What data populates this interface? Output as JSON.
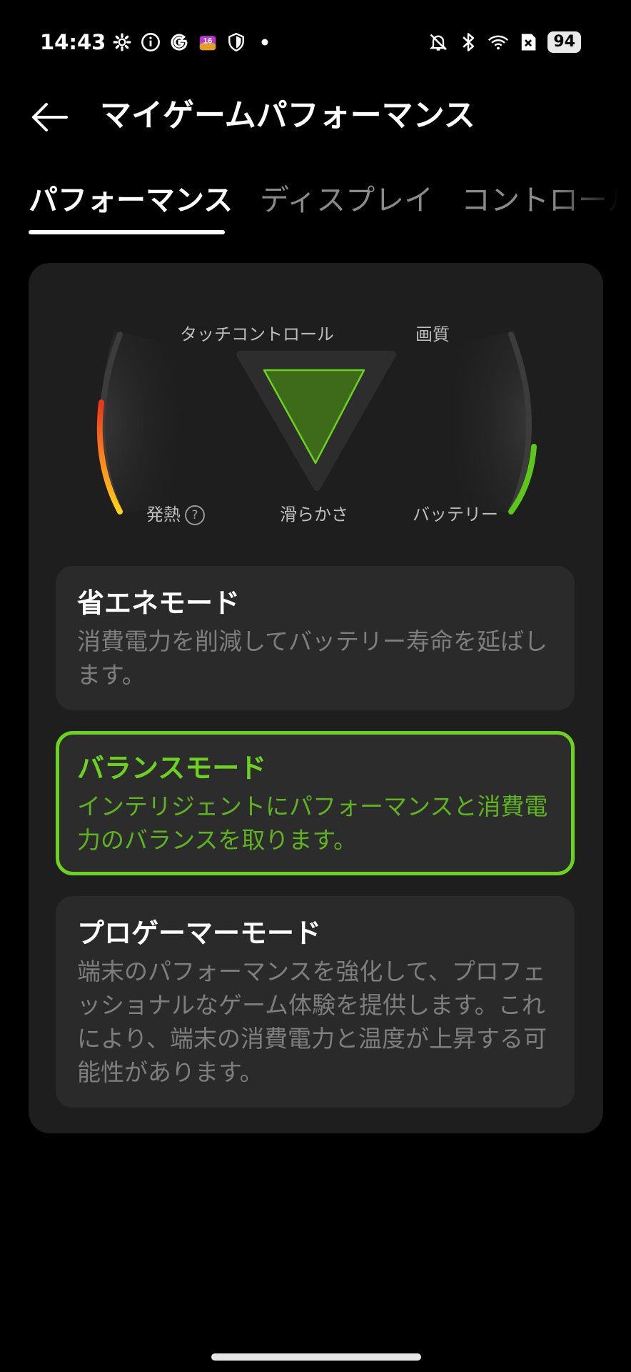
{
  "status_bar": {
    "time": "14:43",
    "left_icons": [
      "gear-icon",
      "info-icon",
      "google-icon",
      "app-icon",
      "shield-icon",
      "dot-icon"
    ],
    "right_icons": [
      "bell-off-icon",
      "bluetooth-icon",
      "wifi-icon",
      "sim-off-icon"
    ],
    "battery": "94"
  },
  "header": {
    "title": "マイゲームパフォーマンス"
  },
  "tabs": [
    {
      "label": "パフォーマンス",
      "active": true
    },
    {
      "label": "ディスプレイ",
      "active": false
    },
    {
      "label": "コントロール",
      "active": false
    }
  ],
  "gauge": {
    "label_touch": "タッチコントロール",
    "label_quality": "画質",
    "label_heat": "発熱",
    "help_symbol": "?",
    "label_smoothness": "滑らかさ",
    "label_battery": "バッテリー",
    "colors": {
      "heat_gradient": [
        "#e8371a",
        "#ff8a1a",
        "#ffd21a"
      ],
      "battery": "#5cc61a",
      "accent": "#6bd31e"
    }
  },
  "modes": [
    {
      "title": "省エネモード",
      "description": "消費電力を削減してバッテリー寿命を延ばします。",
      "selected": false
    },
    {
      "title": "バランスモード",
      "description": "インテリジェントにパフォーマンスと消費電力のバランスを取ります。",
      "selected": true
    },
    {
      "title": "プロゲーマーモード",
      "description": "端末のパフォーマンスを強化して、プロフェッショナルなゲーム体験を提供します。これにより、端末の消費電力と温度が上昇する可能性があります。",
      "selected": false
    }
  ]
}
